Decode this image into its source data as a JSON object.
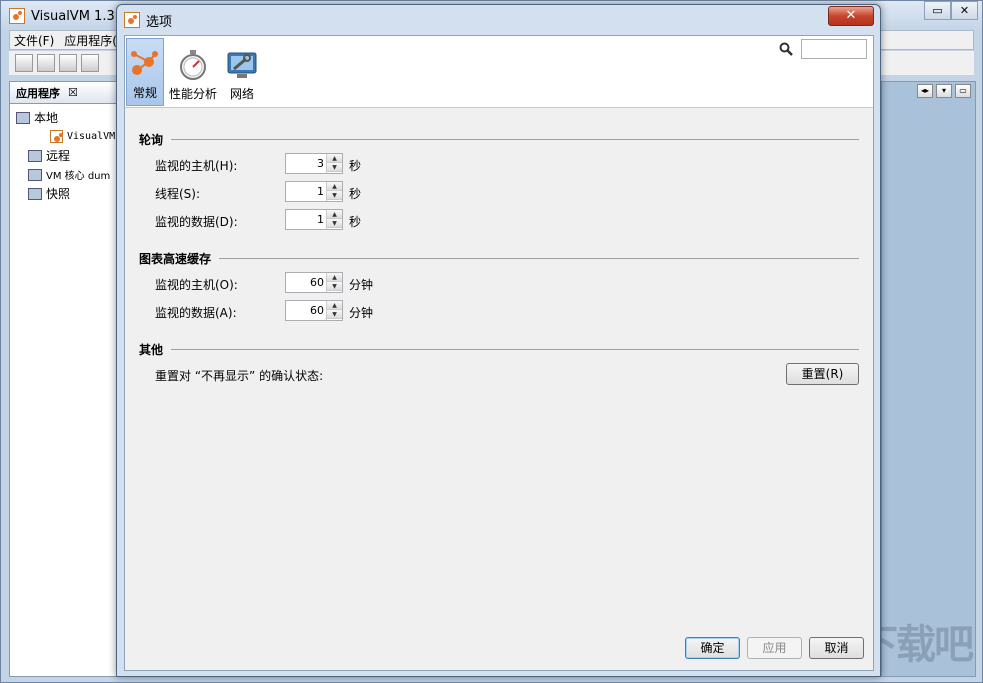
{
  "main_window": {
    "title": "VisualVM 1.3.9",
    "menu": [
      "文件(F)",
      "应用程序(A"
    ],
    "left_tab": "应用程序",
    "tree": [
      {
        "label": "本地",
        "indent": 0
      },
      {
        "label": "VisualVM",
        "indent": 2
      },
      {
        "label": "远程",
        "indent": 0
      },
      {
        "label": "VM 核心 dum",
        "indent": 0
      },
      {
        "label": "快照",
        "indent": 0
      }
    ],
    "watermark": "下载吧"
  },
  "dialog": {
    "title": "选项",
    "close_label": "✕",
    "search": {
      "value": ""
    },
    "categories": [
      {
        "label": "常规",
        "icon": "general-icon",
        "active": true
      },
      {
        "label": "性能分析",
        "icon": "stopwatch-icon",
        "active": false
      },
      {
        "label": "网络",
        "icon": "network-icon",
        "active": false
      }
    ],
    "sections": {
      "polling": {
        "title": "轮询",
        "rows": [
          {
            "label": "监视的主机(H):",
            "value": "3",
            "unit": "秒"
          },
          {
            "label": "线程(S):",
            "value": "1",
            "unit": "秒"
          },
          {
            "label": "监视的数据(D):",
            "value": "1",
            "unit": "秒"
          }
        ]
      },
      "cache": {
        "title": "图表高速缓存",
        "rows": [
          {
            "label": "监视的主机(O):",
            "value": "60",
            "unit": "分钟"
          },
          {
            "label": "监视的数据(A):",
            "value": "60",
            "unit": "分钟"
          }
        ]
      },
      "other": {
        "title": "其他",
        "reset_text": "重置对 “不再显示” 的确认状态:",
        "reset_button": "重置(R)"
      }
    },
    "buttons": {
      "ok": "确定",
      "apply": "应用",
      "cancel": "取消"
    }
  }
}
